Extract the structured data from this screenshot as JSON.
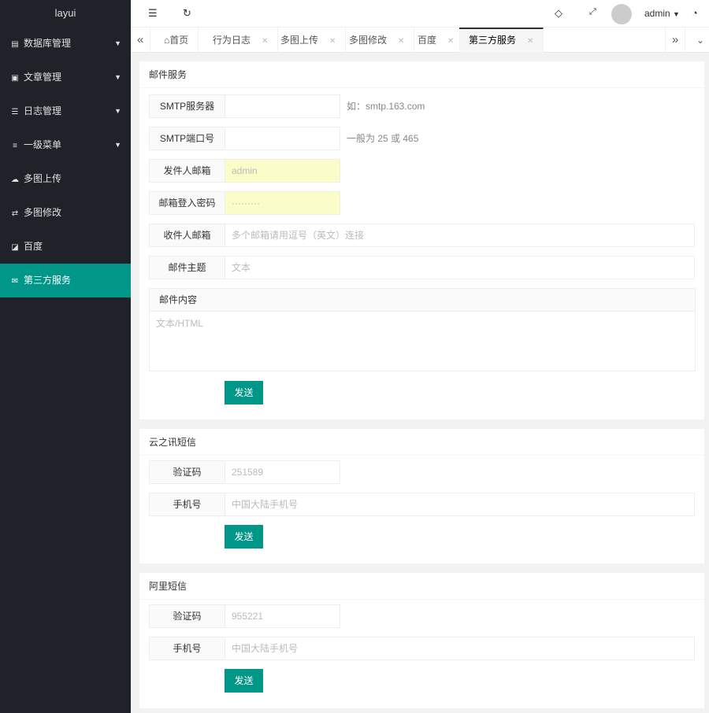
{
  "sidebar": {
    "logo": "layui",
    "items": [
      {
        "label": "数据库管理",
        "icon": "database-icon",
        "caret": true
      },
      {
        "label": "文章管理",
        "icon": "copy-icon",
        "caret": true
      },
      {
        "label": "日志管理",
        "icon": "list-icon",
        "caret": true
      },
      {
        "label": "一级菜单",
        "icon": "menu-icon",
        "caret": true
      },
      {
        "label": "多图上传",
        "icon": "cloud-upload-icon",
        "caret": false
      },
      {
        "label": "多图修改",
        "icon": "exchange-icon",
        "caret": false
      },
      {
        "label": "百度",
        "icon": "external-link-icon",
        "caret": false
      },
      {
        "label": "第三方服务",
        "icon": "mail-icon",
        "caret": false,
        "active": true
      }
    ]
  },
  "header": {
    "user": "admin"
  },
  "tabs": [
    {
      "label": "首页"
    },
    {
      "label": "行为日志"
    },
    {
      "label": "多图上传"
    },
    {
      "label": "多图修改"
    },
    {
      "label": "百度"
    },
    {
      "label": "第三方服务"
    }
  ],
  "mail": {
    "title": "邮件服务",
    "smtp_server": {
      "label": "SMTP服务器",
      "hint": "如：smtp.163.com"
    },
    "smtp_port": {
      "label": "SMTP端口号",
      "hint": "一般为 25 或 465"
    },
    "sender": {
      "label": "发件人邮箱",
      "value": "admin"
    },
    "password": {
      "label": "邮箱登入密码",
      "value": "·········"
    },
    "recipient": {
      "label": "收件人邮箱",
      "placeholder": "多个邮箱请用逗号（英文）连接"
    },
    "subject": {
      "label": "邮件主题",
      "placeholder": "文本"
    },
    "content": {
      "label": "邮件内容",
      "placeholder": "文本/HTML"
    },
    "send": "发送"
  },
  "yunzhixun": {
    "title": "云之讯短信",
    "code": {
      "label": "验证码",
      "value": "251589"
    },
    "phone": {
      "label": "手机号",
      "placeholder": "中国大陆手机号"
    },
    "send": "发送"
  },
  "aliyun": {
    "title": "阿里短信",
    "code": {
      "label": "验证码",
      "value": "955221"
    },
    "phone": {
      "label": "手机号",
      "placeholder": "中国大陆手机号"
    },
    "send": "发送"
  }
}
